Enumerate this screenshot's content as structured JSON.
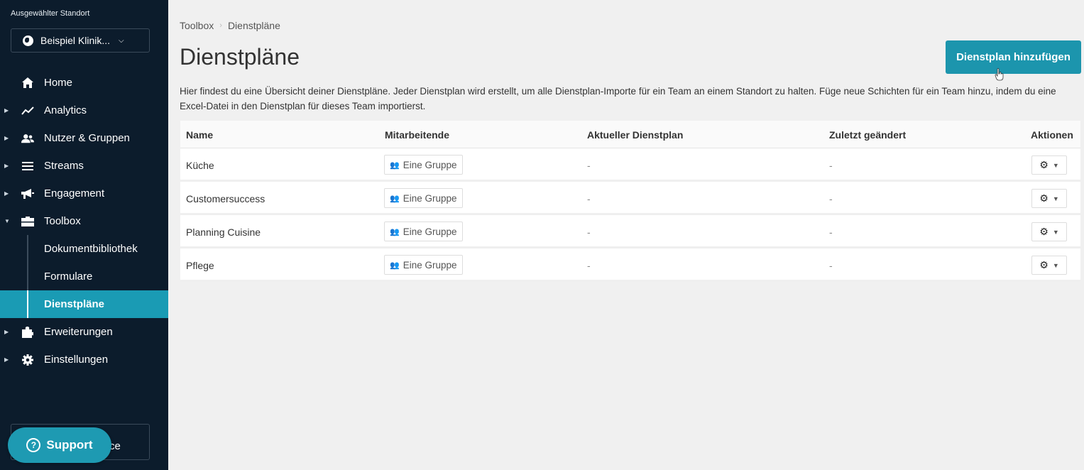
{
  "sidebar": {
    "location_label": "Ausgewählter Standort",
    "location_value": "Beispiel Klinik...",
    "nav": [
      {
        "label": "Home",
        "icon": "home-icon"
      },
      {
        "label": "Analytics",
        "icon": "analytics-icon"
      },
      {
        "label": "Nutzer & Gruppen",
        "icon": "users-icon"
      },
      {
        "label": "Streams",
        "icon": "streams-icon"
      },
      {
        "label": "Engagement",
        "icon": "megaphone-icon"
      },
      {
        "label": "Toolbox",
        "icon": "toolbox-icon"
      }
    ],
    "toolbox_sub": [
      "Dokumentbibliothek",
      "Formulare",
      "Dienstpläne"
    ],
    "nav_after": [
      {
        "label": "Erweiterungen",
        "icon": "puzzle-icon"
      },
      {
        "label": "Einstellungen",
        "icon": "gear-icon"
      }
    ],
    "support_label": "Support",
    "bottom_tail": "ce"
  },
  "main": {
    "breadcrumb": [
      "Toolbox",
      "Dienstpläne"
    ],
    "title": "Dienstpläne",
    "add_button": "Dienstplan hinzufügen",
    "description": "Hier findest du eine Übersicht deiner Dienstpläne. Jeder Dienstplan wird erstellt, um alle Dienstplan-Importe für ein Team an einem Standort zu halten. Füge neue Schichten für ein Team hinzu, indem du eine Excel-Datei in den Dienstplan für dieses Team importierst.",
    "table": {
      "headers": [
        "Name",
        "Mitarbeitende",
        "Aktueller Dienstplan",
        "Zuletzt geändert",
        "Aktionen"
      ],
      "rows": [
        {
          "name": "Küche",
          "group": "Eine Gruppe",
          "current": "-",
          "changed": "-"
        },
        {
          "name": "Customersuccess",
          "group": "Eine Gruppe",
          "current": "-",
          "changed": "-"
        },
        {
          "name": "Planning Cuisine",
          "group": "Eine Gruppe",
          "current": "-",
          "changed": "-"
        },
        {
          "name": "Pflege",
          "group": "Eine Gruppe",
          "current": "-",
          "changed": "-"
        }
      ]
    }
  },
  "colors": {
    "sidebar_bg": "#0c1c2c",
    "accent": "#1c95ad",
    "page_bg": "#f0f0f0"
  }
}
